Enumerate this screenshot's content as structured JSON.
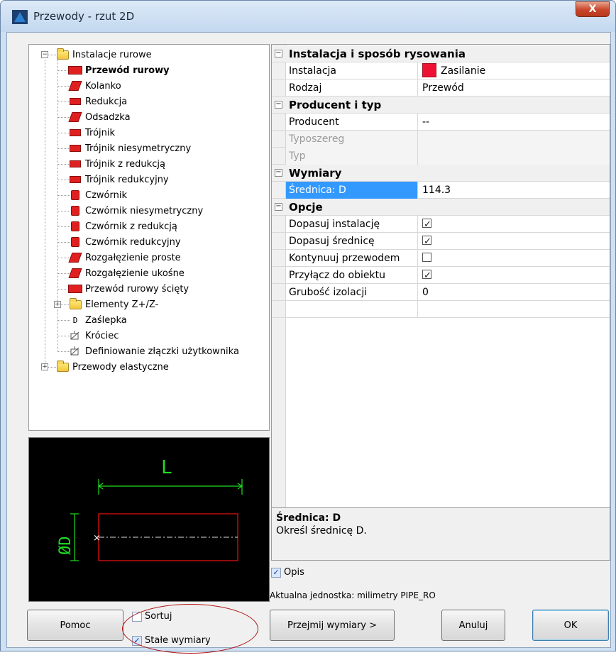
{
  "window": {
    "title": "Przewody - rzut 2D",
    "close_label": "X"
  },
  "tree": {
    "items": [
      {
        "label": "Instalacje rurowe",
        "icon": "folder-icon",
        "level": 0,
        "expander": "−"
      },
      {
        "label": "Przewód rurowy",
        "icon": "pipe-icon",
        "level": 1,
        "bold": true
      },
      {
        "label": "Kolanko",
        "icon": "elbow-icon",
        "level": 1
      },
      {
        "label": "Redukcja",
        "icon": "reduction-icon",
        "level": 1
      },
      {
        "label": "Odsadzka",
        "icon": "offset-icon",
        "level": 1
      },
      {
        "label": "Trójnik",
        "icon": "tee-icon",
        "level": 1
      },
      {
        "label": "Trójnik niesymetryczny",
        "icon": "tee-icon",
        "level": 1
      },
      {
        "label": "Trójnik z redukcją",
        "icon": "tee-icon",
        "level": 1
      },
      {
        "label": "Trójnik redukcyjny",
        "icon": "tee-icon",
        "level": 1
      },
      {
        "label": "Czwórnik",
        "icon": "cross-icon",
        "level": 1
      },
      {
        "label": "Czwórnik niesymetryczny",
        "icon": "cross-icon",
        "level": 1
      },
      {
        "label": "Czwórnik z redukcją",
        "icon": "cross-icon",
        "level": 1
      },
      {
        "label": "Czwórnik redukcyjny",
        "icon": "cross-icon",
        "level": 1
      },
      {
        "label": "Rozgałęzienie proste",
        "icon": "branch-icon",
        "level": 1
      },
      {
        "label": "Rozgałęzienie ukośne",
        "icon": "branch-icon",
        "level": 1
      },
      {
        "label": "Przewód rurowy ścięty",
        "icon": "pipe-icon",
        "level": 1
      },
      {
        "label": "Elementy Z+/Z-",
        "icon": "folder-icon",
        "level": 1,
        "expander": "+"
      },
      {
        "label": "Zaślepka",
        "icon": "cap-icon",
        "level": 1
      },
      {
        "label": "Króciec",
        "icon": "stub-icon",
        "level": 1
      },
      {
        "label": "Definiowanie złączki użytkownika",
        "icon": "user-fitting-icon",
        "level": 1
      },
      {
        "label": "Przewody elastyczne",
        "icon": "folder-icon",
        "level": 0,
        "expander": "+"
      }
    ]
  },
  "preview": {
    "length_label": "L",
    "diameter_label": "ØD"
  },
  "props": {
    "rows": [
      {
        "type": "cat",
        "name": "Instalacja i sposób rysowania"
      },
      {
        "type": "prop",
        "name": "Instalacja",
        "value": "Zasilanie",
        "swatch": "#ee1133"
      },
      {
        "type": "prop",
        "name": "Rodzaj",
        "value": "Przewód"
      },
      {
        "type": "cat",
        "name": "Producent i typ"
      },
      {
        "type": "prop",
        "name": "Producent",
        "value": "--"
      },
      {
        "type": "disabled",
        "name": "Typoszereg",
        "value": ""
      },
      {
        "type": "disabled",
        "name": "Typ",
        "value": ""
      },
      {
        "type": "cat",
        "name": "Wymiary"
      },
      {
        "type": "sel",
        "name": "Średnica: D",
        "value": "114.3"
      },
      {
        "type": "cat",
        "name": "Opcje"
      },
      {
        "type": "check",
        "name": "Dopasuj instalację",
        "checked": true
      },
      {
        "type": "check",
        "name": "Dopasuj średnicę",
        "checked": true
      },
      {
        "type": "check",
        "name": "Kontynuuj przewodem",
        "checked": false
      },
      {
        "type": "check",
        "name": "Przyłącz do obiektu",
        "checked": true
      },
      {
        "type": "prop",
        "name": "Grubość izolacji",
        "value": "0"
      },
      {
        "type": "prop",
        "name": "",
        "value": ""
      }
    ]
  },
  "description": {
    "title": "Średnica: D",
    "text": "Określ średnicę D."
  },
  "opis": {
    "label": "Opis",
    "checked": true
  },
  "unit_line": "Aktualna jednostka: milimetry  PIPE_RO",
  "bottom": {
    "help_label": "Pomoc",
    "sort_label": "Sortuj",
    "sort_checked": false,
    "fixed_label": "Stałe wymiary",
    "fixed_checked": true,
    "take_dims_label": "Przejmij wymiary  >",
    "cancel_label": "Anuluj",
    "ok_label": "OK"
  },
  "colors": {
    "accent_selection": "#3399ff",
    "part_red": "#e02020",
    "preview_green": "#22dd22",
    "preview_red": "#dd1111"
  }
}
